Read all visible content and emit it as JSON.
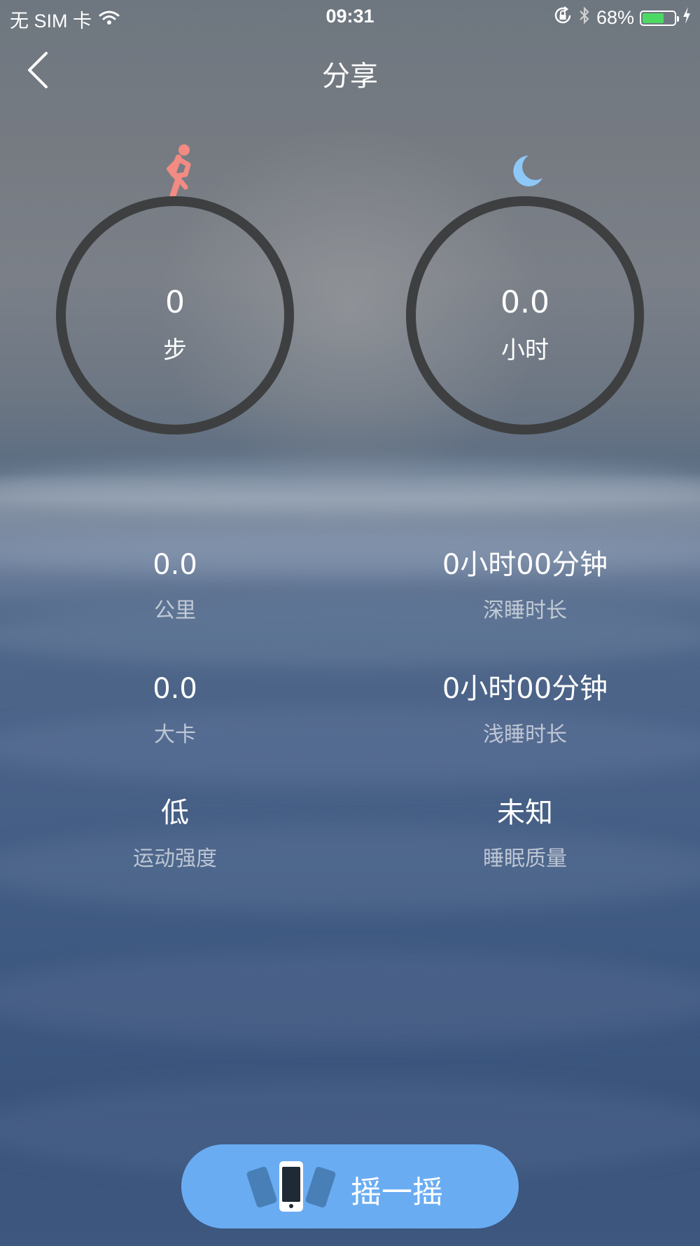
{
  "status_bar": {
    "carrier": "无 SIM 卡",
    "time": "09:31",
    "battery_percent": "68%",
    "battery_level": 0.68,
    "battery_color": "#4cd964"
  },
  "nav": {
    "title": "分享",
    "back_icon": "chevron-left-icon"
  },
  "activity": {
    "icon": "running-person-icon",
    "icon_color": "#f28b82",
    "value": "0",
    "unit": "步"
  },
  "sleep": {
    "icon": "moon-icon",
    "icon_color": "#8ec8f7",
    "value": "0.0",
    "unit": "小时"
  },
  "stats_left": [
    {
      "value": "0.0",
      "label": "公里"
    },
    {
      "value": "0.0",
      "label": "大卡"
    },
    {
      "value": "低",
      "label": "运动强度"
    }
  ],
  "stats_right": [
    {
      "value": "0小时00分钟",
      "label": "深睡时长"
    },
    {
      "value": "0小时00分钟",
      "label": "浅睡时长"
    },
    {
      "value": "未知",
      "label": "睡眠质量"
    }
  ],
  "shake_button": {
    "label": "摇一摇",
    "icon": "shake-phone-icon",
    "color": "#6aacf2"
  }
}
